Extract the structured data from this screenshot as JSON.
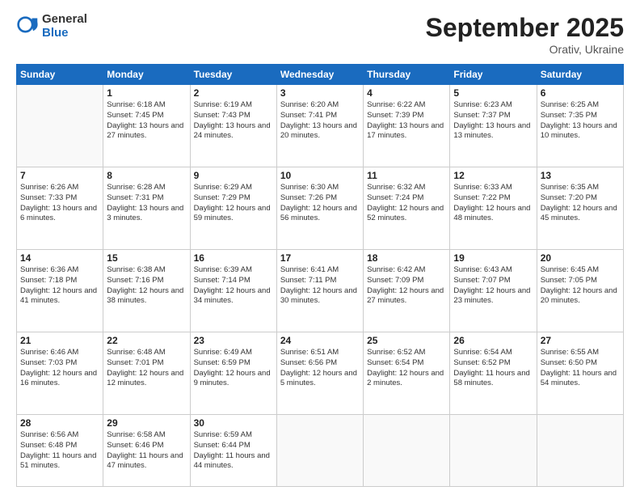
{
  "logo": {
    "general": "General",
    "blue": "Blue"
  },
  "header": {
    "month": "September 2025",
    "location": "Orativ, Ukraine"
  },
  "weekdays": [
    "Sunday",
    "Monday",
    "Tuesday",
    "Wednesday",
    "Thursday",
    "Friday",
    "Saturday"
  ],
  "weeks": [
    [
      {
        "day": null
      },
      {
        "day": 1,
        "sunrise": "6:18 AM",
        "sunset": "7:45 PM",
        "daylight": "13 hours and 27 minutes."
      },
      {
        "day": 2,
        "sunrise": "6:19 AM",
        "sunset": "7:43 PM",
        "daylight": "13 hours and 24 minutes."
      },
      {
        "day": 3,
        "sunrise": "6:20 AM",
        "sunset": "7:41 PM",
        "daylight": "13 hours and 20 minutes."
      },
      {
        "day": 4,
        "sunrise": "6:22 AM",
        "sunset": "7:39 PM",
        "daylight": "13 hours and 17 minutes."
      },
      {
        "day": 5,
        "sunrise": "6:23 AM",
        "sunset": "7:37 PM",
        "daylight": "13 hours and 13 minutes."
      },
      {
        "day": 6,
        "sunrise": "6:25 AM",
        "sunset": "7:35 PM",
        "daylight": "13 hours and 10 minutes."
      }
    ],
    [
      {
        "day": 7,
        "sunrise": "6:26 AM",
        "sunset": "7:33 PM",
        "daylight": "13 hours and 6 minutes."
      },
      {
        "day": 8,
        "sunrise": "6:28 AM",
        "sunset": "7:31 PM",
        "daylight": "13 hours and 3 minutes."
      },
      {
        "day": 9,
        "sunrise": "6:29 AM",
        "sunset": "7:29 PM",
        "daylight": "12 hours and 59 minutes."
      },
      {
        "day": 10,
        "sunrise": "6:30 AM",
        "sunset": "7:26 PM",
        "daylight": "12 hours and 56 minutes."
      },
      {
        "day": 11,
        "sunrise": "6:32 AM",
        "sunset": "7:24 PM",
        "daylight": "12 hours and 52 minutes."
      },
      {
        "day": 12,
        "sunrise": "6:33 AM",
        "sunset": "7:22 PM",
        "daylight": "12 hours and 48 minutes."
      },
      {
        "day": 13,
        "sunrise": "6:35 AM",
        "sunset": "7:20 PM",
        "daylight": "12 hours and 45 minutes."
      }
    ],
    [
      {
        "day": 14,
        "sunrise": "6:36 AM",
        "sunset": "7:18 PM",
        "daylight": "12 hours and 41 minutes."
      },
      {
        "day": 15,
        "sunrise": "6:38 AM",
        "sunset": "7:16 PM",
        "daylight": "12 hours and 38 minutes."
      },
      {
        "day": 16,
        "sunrise": "6:39 AM",
        "sunset": "7:14 PM",
        "daylight": "12 hours and 34 minutes."
      },
      {
        "day": 17,
        "sunrise": "6:41 AM",
        "sunset": "7:11 PM",
        "daylight": "12 hours and 30 minutes."
      },
      {
        "day": 18,
        "sunrise": "6:42 AM",
        "sunset": "7:09 PM",
        "daylight": "12 hours and 27 minutes."
      },
      {
        "day": 19,
        "sunrise": "6:43 AM",
        "sunset": "7:07 PM",
        "daylight": "12 hours and 23 minutes."
      },
      {
        "day": 20,
        "sunrise": "6:45 AM",
        "sunset": "7:05 PM",
        "daylight": "12 hours and 20 minutes."
      }
    ],
    [
      {
        "day": 21,
        "sunrise": "6:46 AM",
        "sunset": "7:03 PM",
        "daylight": "12 hours and 16 minutes."
      },
      {
        "day": 22,
        "sunrise": "6:48 AM",
        "sunset": "7:01 PM",
        "daylight": "12 hours and 12 minutes."
      },
      {
        "day": 23,
        "sunrise": "6:49 AM",
        "sunset": "6:59 PM",
        "daylight": "12 hours and 9 minutes."
      },
      {
        "day": 24,
        "sunrise": "6:51 AM",
        "sunset": "6:56 PM",
        "daylight": "12 hours and 5 minutes."
      },
      {
        "day": 25,
        "sunrise": "6:52 AM",
        "sunset": "6:54 PM",
        "daylight": "12 hours and 2 minutes."
      },
      {
        "day": 26,
        "sunrise": "6:54 AM",
        "sunset": "6:52 PM",
        "daylight": "11 hours and 58 minutes."
      },
      {
        "day": 27,
        "sunrise": "6:55 AM",
        "sunset": "6:50 PM",
        "daylight": "11 hours and 54 minutes."
      }
    ],
    [
      {
        "day": 28,
        "sunrise": "6:56 AM",
        "sunset": "6:48 PM",
        "daylight": "11 hours and 51 minutes."
      },
      {
        "day": 29,
        "sunrise": "6:58 AM",
        "sunset": "6:46 PM",
        "daylight": "11 hours and 47 minutes."
      },
      {
        "day": 30,
        "sunrise": "6:59 AM",
        "sunset": "6:44 PM",
        "daylight": "11 hours and 44 minutes."
      },
      {
        "day": null
      },
      {
        "day": null
      },
      {
        "day": null
      },
      {
        "day": null
      }
    ]
  ]
}
